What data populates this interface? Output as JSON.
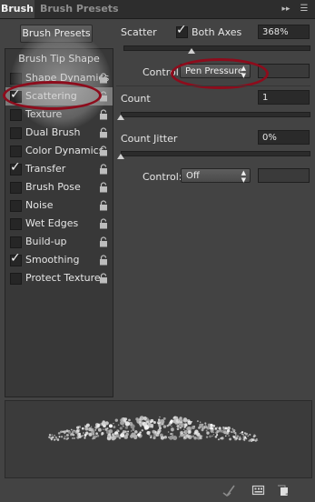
{
  "tabs": {
    "brush": "Brush",
    "brush_presets": "Brush Presets"
  },
  "header_icons": {
    "collapse": "double-chevron-right-icon",
    "menu": "panel-menu-icon"
  },
  "presets_button": "Brush Presets",
  "brush_tip_shape": "Brush Tip Shape",
  "options": [
    {
      "label": "Shape Dynamics",
      "checked": false,
      "locked": true
    },
    {
      "label": "Scattering",
      "checked": true,
      "locked": true,
      "selected": true
    },
    {
      "label": "Texture",
      "checked": false,
      "locked": true
    },
    {
      "label": "Dual Brush",
      "checked": false,
      "locked": true
    },
    {
      "label": "Color Dynamics",
      "checked": false,
      "locked": true
    },
    {
      "label": "Transfer",
      "checked": true,
      "locked": true
    },
    {
      "label": "Brush Pose",
      "checked": false,
      "locked": true
    },
    {
      "label": "Noise",
      "checked": false,
      "locked": true
    },
    {
      "label": "Wet Edges",
      "checked": false,
      "locked": true
    },
    {
      "label": "Build-up",
      "checked": false,
      "locked": true
    },
    {
      "label": "Smoothing",
      "checked": true,
      "locked": true
    },
    {
      "label": "Protect Texture",
      "checked": false,
      "locked": true
    }
  ],
  "scatter": {
    "label": "Scatter",
    "both_axes_label": "Both Axes",
    "both_axes_checked": true,
    "value": "368%",
    "slider_level": 0.368,
    "control_label": "Control:",
    "control_value": "Pen Pressure"
  },
  "count": {
    "label": "Count",
    "value": "1",
    "slider_level": 0.0
  },
  "count_jitter": {
    "label": "Count Jitter",
    "value": "0%",
    "slider_level": 0.0,
    "control_label": "Control:",
    "control_value": "Off"
  },
  "bottom_icons": [
    "toggle-live-tip-preview-icon",
    "create-new-brush-icon",
    "new-preset-icon"
  ],
  "colors": {
    "panel_bg": "#434343",
    "annotation_red": "#8d0c1c",
    "selected_row": "#7b7b7b"
  }
}
